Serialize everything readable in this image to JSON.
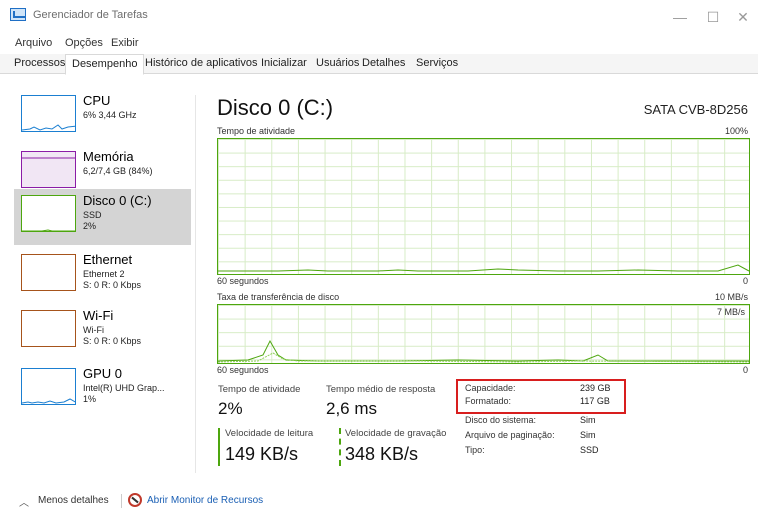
{
  "window": {
    "title": "Gerenciador de Tarefas",
    "minimize": "—",
    "maximize": "☐",
    "close": "✕"
  },
  "menu": {
    "items": [
      "Arquivo",
      "Opções",
      "Exibir"
    ]
  },
  "tabs": [
    "Processos",
    "Desempenho",
    "Histórico de aplicativos",
    "Inicializar",
    "Usuários",
    "Detalhes",
    "Serviços"
  ],
  "active_tab": "Desempenho",
  "sidebar": {
    "items": [
      {
        "title": "CPU",
        "line1": "6% 3,44 GHz",
        "line2": "",
        "icon": "cpu-graph-icon",
        "color": "#1b7fd1"
      },
      {
        "title": "Memória",
        "line1": "6,2/7,4 GB (84%)",
        "line2": "",
        "icon": "memory-graph-icon",
        "color": "#8b1ca6"
      },
      {
        "title": "Disco 0 (C:)",
        "line1": "SSD",
        "line2": "2%",
        "icon": "disk-graph-icon",
        "color": "#4da60e"
      },
      {
        "title": "Ethernet",
        "line1": "Ethernet 2",
        "line2": "S: 0 R: 0 Kbps",
        "icon": "ethernet-graph-icon",
        "color": "#a6531b"
      },
      {
        "title": "Wi-Fi",
        "line1": "Wi-Fi",
        "line2": "S: 0 R: 0 Kbps",
        "icon": "wifi-graph-icon",
        "color": "#a6531b"
      },
      {
        "title": "GPU 0",
        "line1": "Intel(R) UHD Grap...",
        "line2": "1%",
        "icon": "gpu-graph-icon",
        "color": "#1b7fd1"
      }
    ]
  },
  "main": {
    "title": "Disco 0 (C:)",
    "model": "SATA CVB-8D256",
    "graph1": {
      "label": "Tempo de atividade",
      "max": "100%",
      "time": "60 segundos",
      "min": "0"
    },
    "graph2": {
      "label": "Taxa de transferência de disco",
      "max": "10 MB/s",
      "secondary": "7 MB/s",
      "time": "60 segundos",
      "min": "0"
    },
    "stats": {
      "active_time_label": "Tempo de atividade",
      "active_time_value": "2%",
      "response_label": "Tempo médio de resposta",
      "response_value": "2,6 ms",
      "read_label": "Velocidade de leitura",
      "read_value": "149 KB/s",
      "write_label": "Velocidade de gravação",
      "write_value": "348 KB/s"
    },
    "properties": [
      {
        "label": "Capacidade:",
        "value": "239 GB"
      },
      {
        "label": "Formatado:",
        "value": "117 GB"
      },
      {
        "label": "Disco do sistema:",
        "value": "Sim"
      },
      {
        "label": "Arquivo de paginação:",
        "value": "Sim"
      },
      {
        "label": "Tipo:",
        "value": "SSD"
      }
    ],
    "highlight_color": "#d81e1e",
    "accent_color": "#4da60e"
  },
  "footer": {
    "less_details": "Menos detalhes",
    "monitor_link": "Abrir Monitor de Recursos"
  }
}
